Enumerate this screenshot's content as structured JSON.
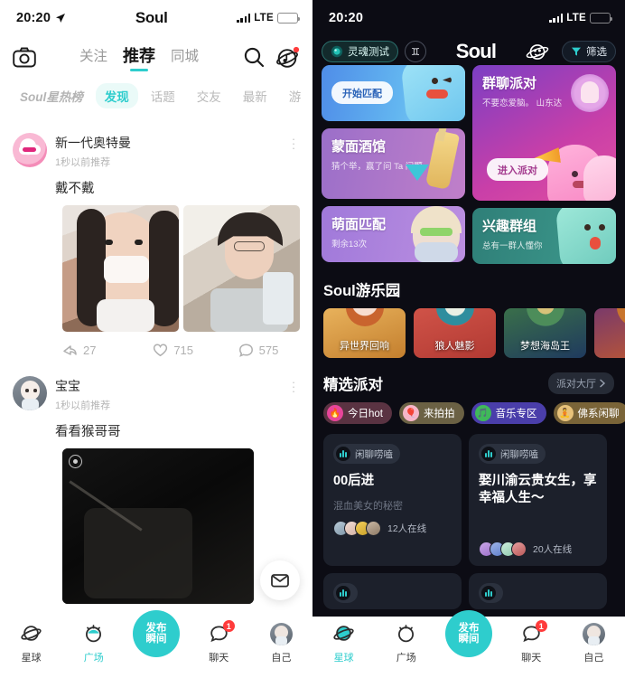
{
  "left": {
    "status": {
      "time": "20:20",
      "carrier": "LTE",
      "title": "Soul",
      "location_icon": "location-arrow-icon"
    },
    "nav": {
      "camera_icon": "camera-icon",
      "search_icon": "search-icon",
      "music_icon": "music-planet-icon",
      "tabs": [
        {
          "label": "关注",
          "active": false
        },
        {
          "label": "推荐",
          "active": true
        },
        {
          "label": "同城",
          "active": false
        }
      ]
    },
    "subtabs": [
      {
        "label": "Soul星热榜",
        "active": false,
        "style": "rank"
      },
      {
        "label": "发现",
        "active": true,
        "style": ""
      },
      {
        "label": "话题",
        "active": false,
        "style": ""
      },
      {
        "label": "交友",
        "active": false,
        "style": ""
      },
      {
        "label": "最新",
        "active": false,
        "style": ""
      },
      {
        "label": "游",
        "active": false,
        "style": ""
      }
    ],
    "posts": [
      {
        "name": "新一代奥特曼",
        "time": "1秒以前推荐",
        "text": "戴不戴",
        "more_icon": "more-vertical-icon",
        "actions": {
          "share_icon": "share-icon",
          "share_count": "27",
          "like_icon": "heart-icon",
          "like_count": "715",
          "comment_icon": "comment-icon",
          "comment_count": "575"
        }
      },
      {
        "name": "宝宝",
        "time": "1秒以前推荐",
        "text": "看看猴哥哥",
        "more_icon": "more-vertical-icon"
      }
    ],
    "fab_icon": "envelope-icon",
    "tabbar": [
      {
        "label": "星球",
        "icon": "planet-icon",
        "active": false,
        "badge": ""
      },
      {
        "label": "广场",
        "icon": "square-icon",
        "active": true,
        "badge": ""
      },
      {
        "label": "聊天",
        "icon": "chat-icon",
        "active": false,
        "badge": "1"
      },
      {
        "label": "自己",
        "icon": "profile-avatar-icon",
        "active": false,
        "badge": ""
      }
    ],
    "publish": {
      "line1": "发布",
      "line2": "瞬间"
    }
  },
  "right": {
    "status": {
      "time": "20:20",
      "carrier": "LTE"
    },
    "nav": {
      "soul_test": "灵魂测试",
      "soul_test_icon": "soul-orb-icon",
      "zodiac_icon": "gemini-icon",
      "zodiac_glyph": "♊",
      "logo": "Soul",
      "planet_icon": "planet-face-icon",
      "filter": "筛选",
      "filter_icon": "funnel-icon"
    },
    "cards": [
      {
        "key": "match",
        "title": "",
        "sub": "",
        "button": "开始匹配"
      },
      {
        "key": "bar",
        "title": "蒙面酒馆",
        "sub": "猜个举，赢了问 Ta 问题",
        "button": ""
      },
      {
        "key": "face",
        "title": "萌面匹配",
        "sub": "剩余13次",
        "button": ""
      },
      {
        "key": "group",
        "title": "群聊派对",
        "sub": "不要恋爱脑。    山东达",
        "button": "进入派对"
      },
      {
        "key": "interest",
        "title": "兴趣群组",
        "sub": "总有一群人懂你",
        "button": ""
      }
    ],
    "park": {
      "title": "Soul游乐园",
      "games": [
        {
          "name": "异世界回响"
        },
        {
          "name": "狼人魅影"
        },
        {
          "name": "梦想海岛王"
        },
        {
          "name": ""
        }
      ]
    },
    "featured": {
      "title": "精选派对",
      "hall": "派对大厅",
      "hall_chevron": "chevron-right-icon",
      "chips": [
        {
          "label": "今日hot",
          "icon": "flame-icon",
          "glyph": "🔥"
        },
        {
          "label": "来拍拍",
          "icon": "balloon-icon",
          "glyph": "🎈"
        },
        {
          "label": "音乐专区",
          "icon": "music-note-icon",
          "glyph": "🎵"
        },
        {
          "label": "佛系闲聊",
          "icon": "buddha-icon",
          "glyph": "🧘"
        }
      ],
      "parties": [
        {
          "tag": "闲聊唠嗑",
          "title": "00后进",
          "sub": "混血美女的秘密",
          "online": "12人在线"
        },
        {
          "tag": "闲聊唠嗑",
          "title": "娶川渝云贵女生，享幸福人生～",
          "sub": "",
          "online": "20人在线"
        }
      ]
    },
    "tabbar": [
      {
        "label": "星球",
        "icon": "planet-icon",
        "active": true,
        "badge": ""
      },
      {
        "label": "广场",
        "icon": "square-icon",
        "active": false,
        "badge": ""
      },
      {
        "label": "聊天",
        "icon": "chat-icon",
        "active": false,
        "badge": "1"
      },
      {
        "label": "自己",
        "icon": "profile-avatar-icon",
        "active": false,
        "badge": ""
      }
    ],
    "publish": {
      "line1": "发布",
      "line2": "瞬间"
    }
  }
}
